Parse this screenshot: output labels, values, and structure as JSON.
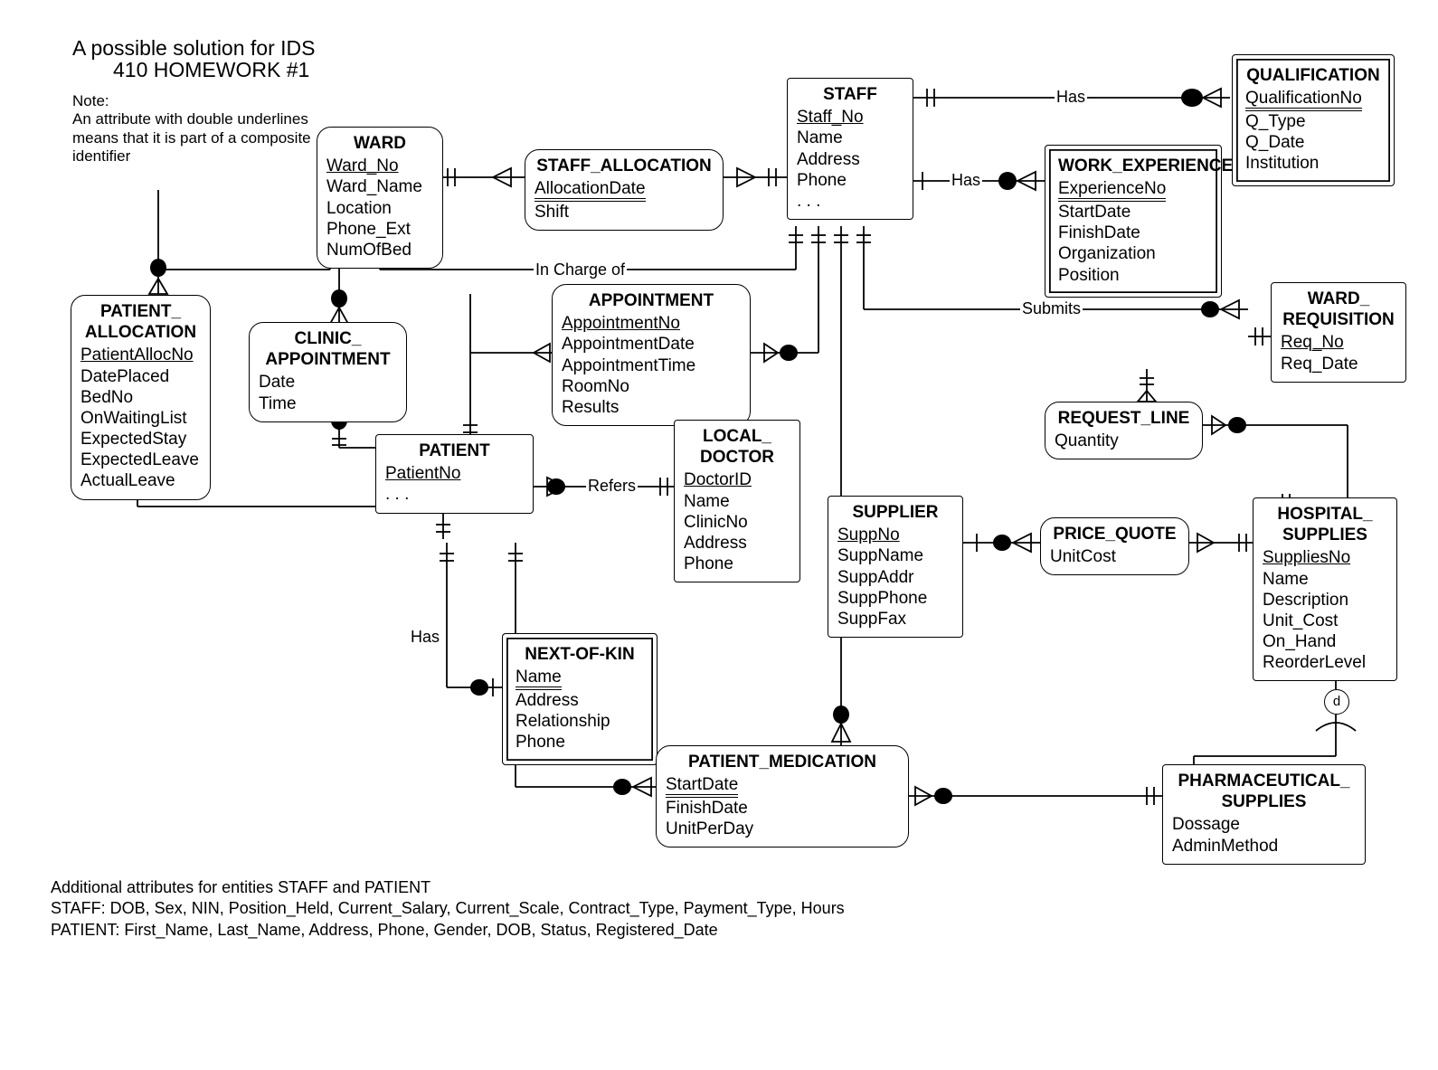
{
  "titles": {
    "line1": "A possible solution for IDS",
    "line2": "410 HOMEWORK #1"
  },
  "note": {
    "label": "Note:",
    "text": "An attribute with double underlines  means that it is part of a composite identifier"
  },
  "entities": {
    "ward": {
      "title": "WARD",
      "attrs": [
        "Ward_No",
        "Ward_Name",
        "Location",
        "Phone_Ext",
        "NumOfBed"
      ]
    },
    "staff": {
      "title": "STAFF",
      "attrs": [
        "Staff_No",
        "Name",
        "Address",
        "Phone",
        ". . ."
      ]
    },
    "staff_allocation": {
      "title": "STAFF_ALLOCATION",
      "attrs": [
        "AllocationDate",
        "Shift"
      ]
    },
    "qualification": {
      "title": "QUALIFICATION",
      "attrs": [
        "QualificationNo",
        "Q_Type",
        "Q_Date",
        "Institution"
      ]
    },
    "work_experience": {
      "title": "WORK_EXPERIENCE",
      "attrs": [
        "ExperienceNo",
        "StartDate",
        "FinishDate",
        "Organization",
        "Position"
      ]
    },
    "patient_allocation": {
      "title": "PATIENT_ ALLOCATION",
      "attrs": [
        "PatientAllocNo",
        "DatePlaced",
        "BedNo",
        "OnWaitingList",
        "ExpectedStay",
        "ExpectedLeave",
        "ActualLeave"
      ]
    },
    "clinic_appointment": {
      "title": "CLINIC_ APPOINTMENT",
      "attrs": [
        "Date",
        "Time"
      ]
    },
    "appointment": {
      "title": "APPOINTMENT",
      "attrs": [
        "AppointmentNo",
        "AppointmentDate",
        "AppointmentTime",
        "RoomNo",
        "Results"
      ]
    },
    "ward_requisition": {
      "title": "WARD_ REQUISITION",
      "attrs": [
        "Req_No",
        "Req_Date"
      ]
    },
    "request_line": {
      "title": "REQUEST_LINE",
      "attrs": [
        "Quantity"
      ]
    },
    "patient": {
      "title": "PATIENT",
      "attrs": [
        "PatientNo",
        ". . ."
      ]
    },
    "local_doctor": {
      "title": "LOCAL_ DOCTOR",
      "attrs": [
        "DoctorID",
        "Name",
        "ClinicNo",
        "Address",
        "Phone"
      ]
    },
    "supplier": {
      "title": "SUPPLIER",
      "attrs": [
        "SuppNo",
        "SuppName",
        "SuppAddr",
        "SuppPhone",
        "SuppFax"
      ]
    },
    "price_quote": {
      "title": "PRICE_QUOTE",
      "attrs": [
        "UnitCost"
      ]
    },
    "hospital_supplies": {
      "title": "HOSPITAL_ SUPPLIES",
      "attrs": [
        "SuppliesNo",
        "Name",
        "Description",
        "Unit_Cost",
        "On_Hand",
        "ReorderLevel"
      ]
    },
    "next_of_kin": {
      "title": "NEXT-OF-KIN",
      "attrs": [
        "Name",
        "Address",
        "Relationship",
        "Phone"
      ]
    },
    "patient_medication": {
      "title": "PATIENT_MEDICATION",
      "attrs": [
        "StartDate",
        "FinishDate",
        "UnitPerDay"
      ]
    },
    "pharmaceutical_supplies": {
      "title": "PHARMACEUTICAL_ SUPPLIES",
      "attrs": [
        "Dossage",
        "AdminMethod"
      ]
    }
  },
  "relationships": {
    "has1": "Has",
    "has2": "Has",
    "has3": "Has",
    "in_charge_of": "In Charge of",
    "submits": "Submits",
    "refers": "Refers"
  },
  "disjoint": "d",
  "footer": {
    "l1": "Additional attributes for entities STAFF and PATIENT",
    "l2": "STAFF: DOB, Sex, NIN, Position_Held, Current_Salary, Current_Scale, Contract_Type, Payment_Type, Hours",
    "l3": "PATIENT: First_Name, Last_Name, Address, Phone, Gender, DOB, Status, Registered_Date"
  }
}
